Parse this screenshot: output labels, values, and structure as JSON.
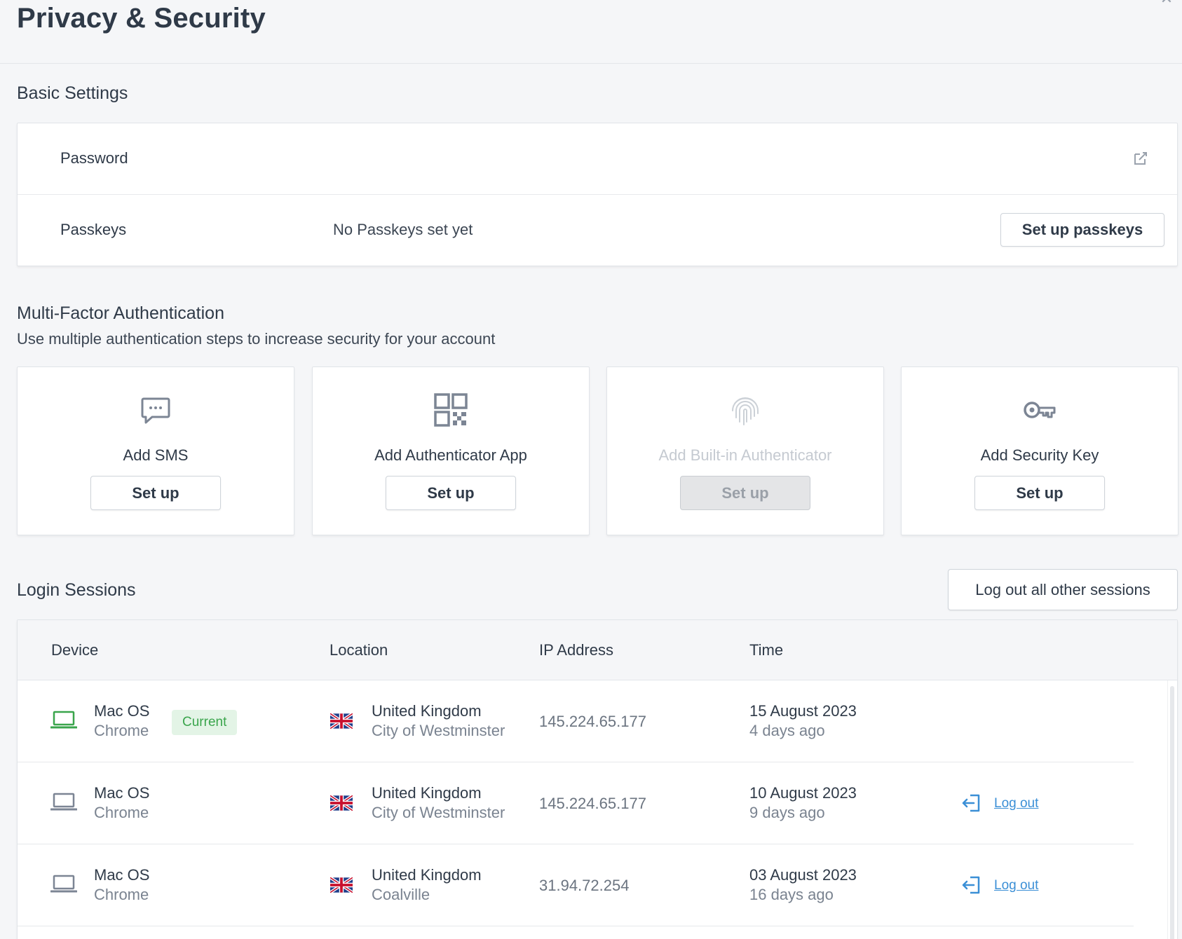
{
  "header": {
    "title": "Privacy & Security"
  },
  "basic": {
    "title": "Basic Settings",
    "password_label": "Password",
    "passkeys_label": "Passkeys",
    "passkeys_value": "No Passkeys set yet",
    "passkeys_button": "Set up passkeys"
  },
  "mfa": {
    "title": "Multi-Factor Authentication",
    "description": "Use multiple authentication steps to increase security for your account",
    "options": [
      {
        "label": "Add SMS",
        "button": "Set up",
        "icon": "sms-icon",
        "enabled": true
      },
      {
        "label": "Add Authenticator App",
        "button": "Set up",
        "icon": "qr-code-icon",
        "enabled": true
      },
      {
        "label": "Add Built-in Authenticator",
        "button": "Set up",
        "icon": "fingerprint-icon",
        "enabled": false
      },
      {
        "label": "Add Security Key",
        "button": "Set up",
        "icon": "key-icon",
        "enabled": true
      }
    ]
  },
  "sessions": {
    "title": "Login Sessions",
    "logout_all": "Log out all other sessions",
    "columns": {
      "device": "Device",
      "location": "Location",
      "ip": "IP Address",
      "time": "Time"
    },
    "rows": [
      {
        "os": "Mac OS",
        "browser": "Chrome",
        "badge": "Current",
        "country": "United Kingdom",
        "city": "City of Westminster",
        "ip": "145.224.65.177",
        "date": "15 August 2023",
        "ago": "4 days ago",
        "logout": ""
      },
      {
        "os": "Mac OS",
        "browser": "Chrome",
        "badge": "",
        "country": "United Kingdom",
        "city": "City of Westminster",
        "ip": "145.224.65.177",
        "date": "10 August 2023",
        "ago": "9 days ago",
        "logout": "Log out"
      },
      {
        "os": "Mac OS",
        "browser": "Chrome",
        "badge": "",
        "country": "United Kingdom",
        "city": "Coalville",
        "ip": "31.94.72.254",
        "date": "03 August 2023",
        "ago": "16 days ago",
        "logout": "Log out"
      }
    ]
  },
  "colors": {
    "current_device": "#3aa54c",
    "other_device": "#7c8594",
    "link": "#3b8fd6",
    "icon": "#7c8594"
  }
}
